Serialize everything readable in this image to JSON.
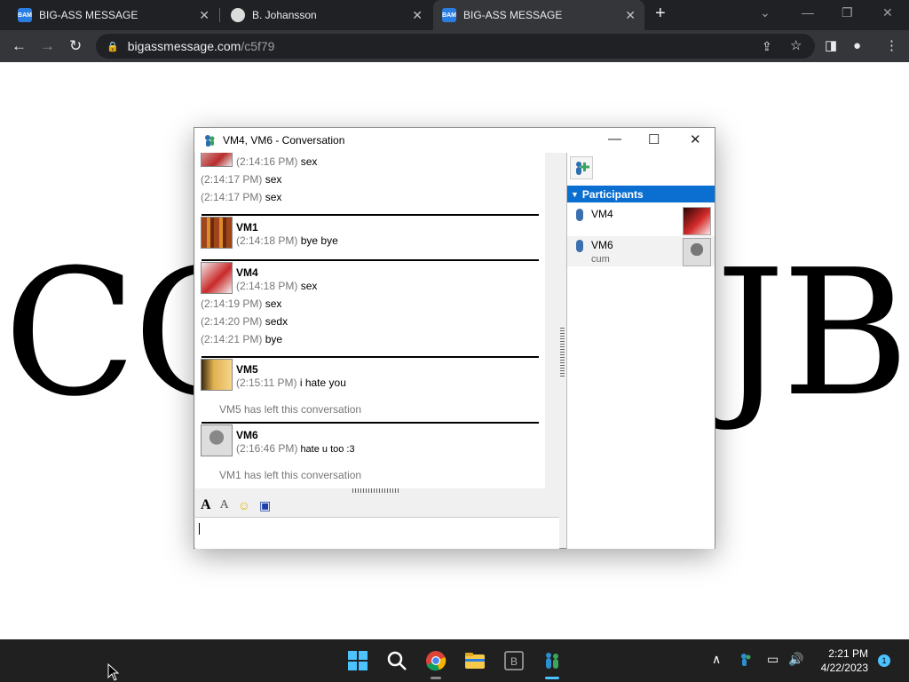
{
  "browser": {
    "tabs": [
      {
        "title": "BIG-ASS MESSAGE",
        "favicon": "BAM",
        "active": false
      },
      {
        "title": "B. Johansson",
        "favicon": "doc",
        "active": false
      },
      {
        "title": "BIG-ASS MESSAGE",
        "favicon": "BAM",
        "active": true
      }
    ],
    "url_host": "bigassmessage.com",
    "url_path": "/c5f79"
  },
  "page": {
    "big_left": "CO",
    "big_right": "JB"
  },
  "window": {
    "title": "VM4, VM6 - Conversation"
  },
  "chat": {
    "top_lines": [
      {
        "time": "(2:14:16 PM)",
        "text": "sex"
      },
      {
        "time": "(2:14:17 PM)",
        "text": "sex"
      },
      {
        "time": "(2:14:17 PM)",
        "text": "sex"
      }
    ],
    "blocks": [
      {
        "name": "VM1",
        "lines": [
          {
            "time": "(2:14:18 PM)",
            "text": "bye bye"
          }
        ]
      },
      {
        "name": "VM4",
        "lines": [
          {
            "time": "(2:14:18 PM)",
            "text": "sex"
          }
        ]
      },
      {
        "name": "VM5",
        "lines": [
          {
            "time": "(2:15:11 PM)",
            "text": "i hate you"
          }
        ]
      },
      {
        "name": "VM6",
        "lines": [
          {
            "time": "(2:16:46 PM)",
            "text": "hate u too :3"
          }
        ]
      }
    ],
    "vm4_extra": [
      {
        "time": "(2:14:19 PM)",
        "text": "sex"
      },
      {
        "time": "(2:14:20 PM)",
        "text": "sedx"
      },
      {
        "time": "(2:14:21 PM)",
        "text": "bye"
      }
    ],
    "system": [
      "VM5 has left this conversation",
      "VM1 has left this conversation"
    ]
  },
  "participants": {
    "header": "Participants",
    "list": [
      {
        "name": "VM4",
        "status": ""
      },
      {
        "name": "VM6",
        "status": "cum"
      }
    ]
  },
  "taskbar": {
    "time": "2:21 PM",
    "date": "4/22/2023",
    "notifications": "1"
  }
}
